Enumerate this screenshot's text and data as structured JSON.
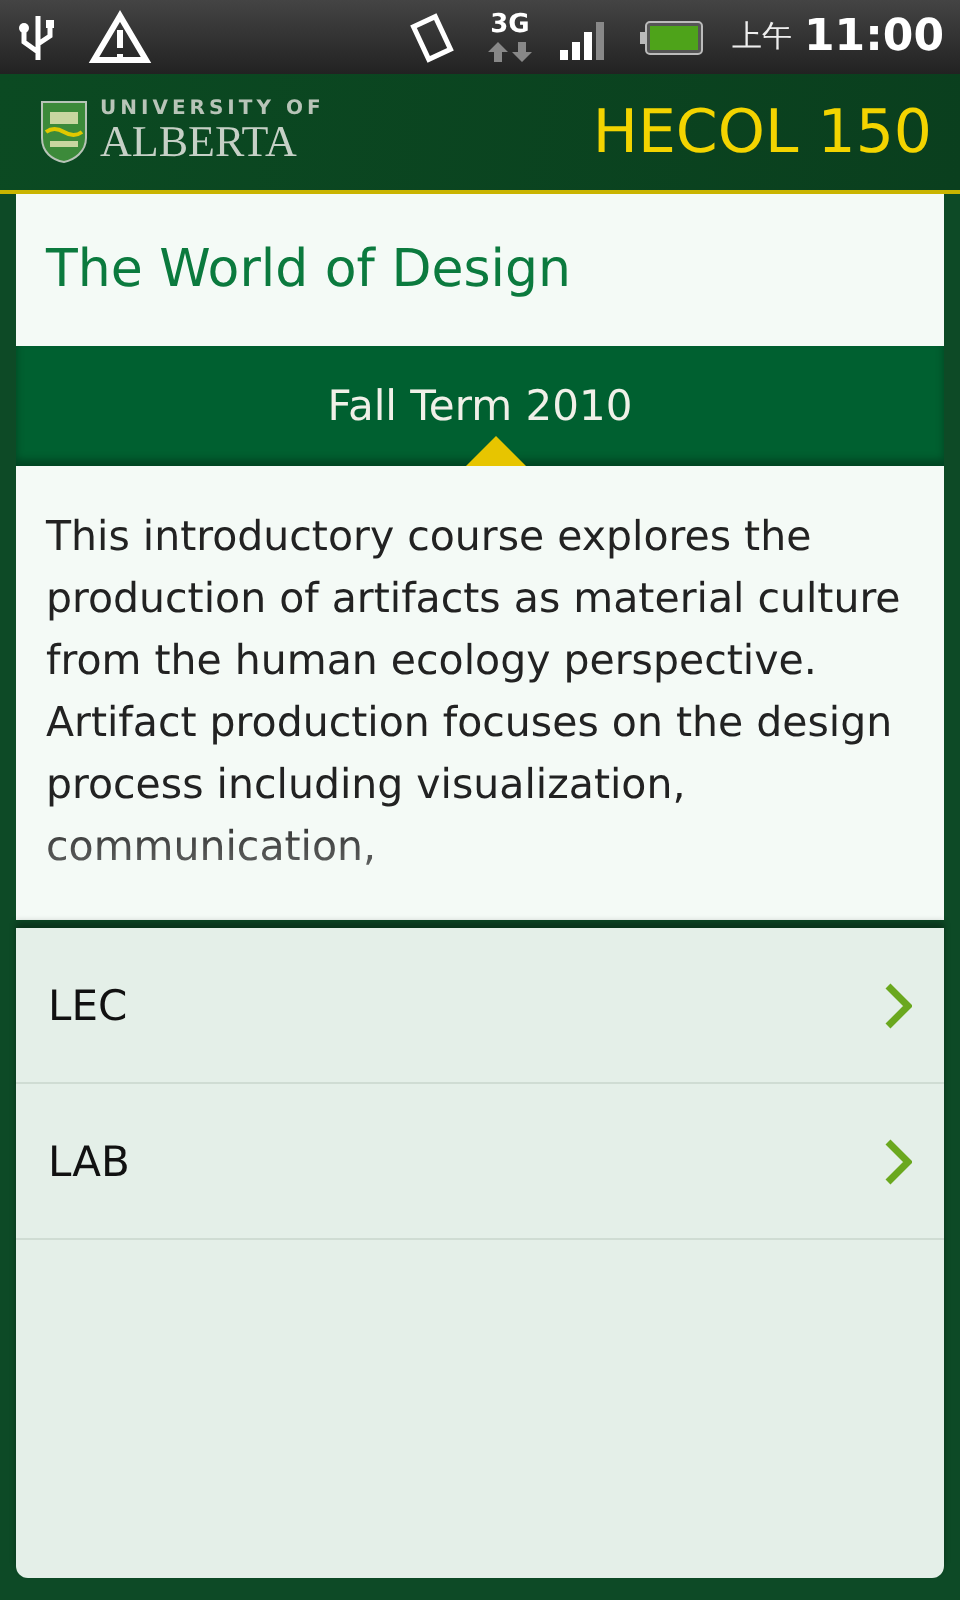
{
  "status_bar": {
    "network": "3G",
    "am_pm": "上午",
    "time": "11:00"
  },
  "header": {
    "logo_top": "UNIVERSITY OF",
    "logo_bottom": "ALBERTA",
    "course_code": "HECOL 150"
  },
  "course": {
    "title": "The World of Design",
    "term": "Fall Term 2010",
    "description": "This introductory course explores the production of artifacts as material culture from the human ecology perspective. Artifact production focuses on the design process including visualization, communication,"
  },
  "sections": [
    {
      "label": "LEC"
    },
    {
      "label": "LAB"
    }
  ]
}
